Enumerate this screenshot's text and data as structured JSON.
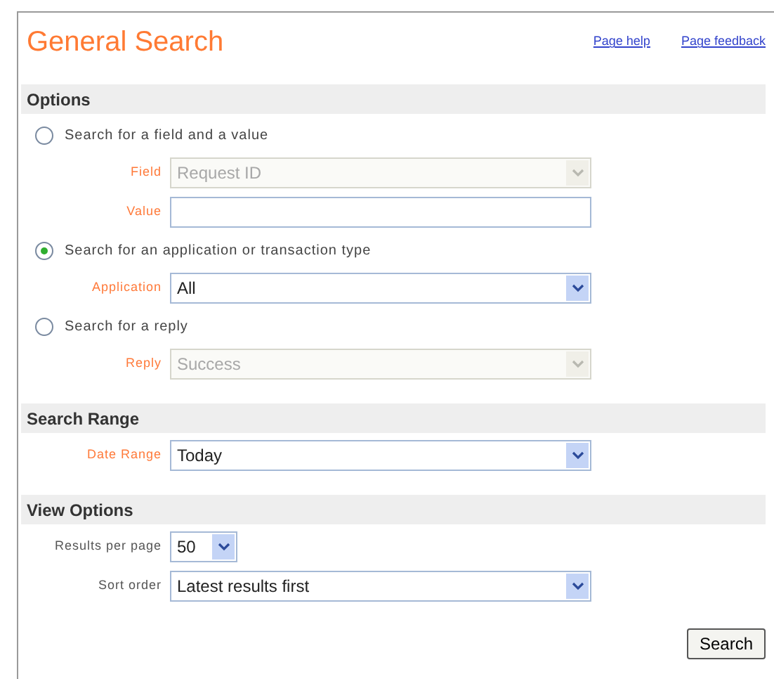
{
  "title": "General Search",
  "links": [
    "Page help",
    "Page feedback"
  ],
  "sections": [
    {
      "heading": "Options",
      "items": [
        {
          "kind": "radio",
          "label": "Search for a field and a value",
          "selected": false
        },
        {
          "kind": "select",
          "label": "Field",
          "value": "Request ID",
          "disabled": true,
          "emphasized": true
        },
        {
          "kind": "input",
          "label": "Value",
          "value": "",
          "disabled": false,
          "emphasized": true
        },
        {
          "kind": "radio",
          "label": "Search for an application or transaction type",
          "selected": true
        },
        {
          "kind": "select",
          "label": "Application",
          "value": "All",
          "disabled": false,
          "emphasized": true
        },
        {
          "kind": "radio",
          "label": "Search for a reply",
          "selected": false
        },
        {
          "kind": "select",
          "label": "Reply",
          "value": "Success",
          "disabled": true,
          "emphasized": true
        }
      ]
    },
    {
      "heading": "Search Range",
      "items": [
        {
          "kind": "select",
          "label": "Date Range",
          "value": "Today",
          "disabled": false,
          "emphasized": true
        }
      ]
    },
    {
      "heading": "View Options",
      "items": [
        {
          "kind": "small-select",
          "label": "Results per page",
          "value": "50",
          "disabled": false,
          "emphasized": false
        },
        {
          "kind": "select",
          "label": "Sort order",
          "value": "Latest results first",
          "disabled": false,
          "emphasized": false
        }
      ]
    }
  ],
  "search_button": "Search"
}
